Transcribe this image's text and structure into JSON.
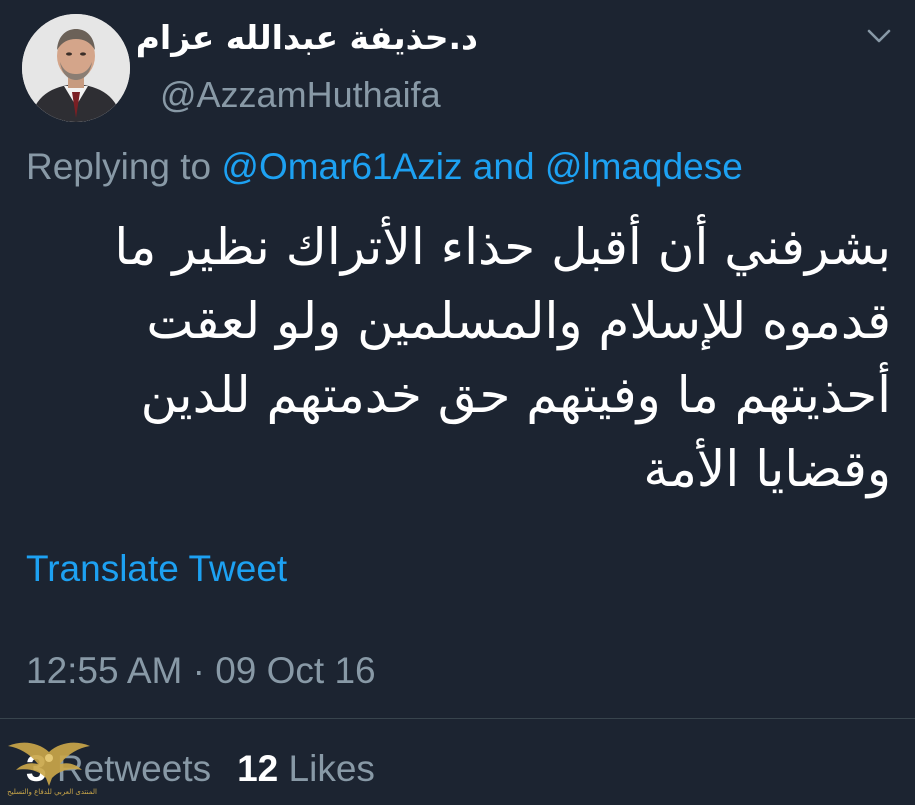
{
  "tweet": {
    "display_name": "د.حذيفة عبدالله عزام",
    "handle": "@AzzamHuthaifa",
    "replying_prefix": "Replying to",
    "replying_mention_1": "@Omar61Aziz",
    "replying_and": "and",
    "replying_mention_2": "@lmaqdese",
    "body": "بشرفني أن أقبل حذاء الأتراك نظير ما قدموه للإسلام والمسلمين ولو لعقت أحذيتهم ما وفيتهم حق خدمتهم للدين وقضايا الأمة",
    "translate_label": "Translate Tweet",
    "timestamp": "12:55 AM · 09 Oct 16",
    "retweets_count": "3",
    "retweets_label": "Retweets",
    "likes_count": "12",
    "likes_label": "Likes"
  },
  "watermark": {
    "text": "المنتدى العربي للدفاع والتسليح"
  },
  "icons": {
    "menu": "chevron-down-icon",
    "watermark": "eagle-logo-icon"
  },
  "colors": {
    "background": "#1c2431",
    "link": "#1da1f2",
    "secondary_text": "#8899a6",
    "primary_text": "#ffffff",
    "watermark": "#c9a649"
  }
}
